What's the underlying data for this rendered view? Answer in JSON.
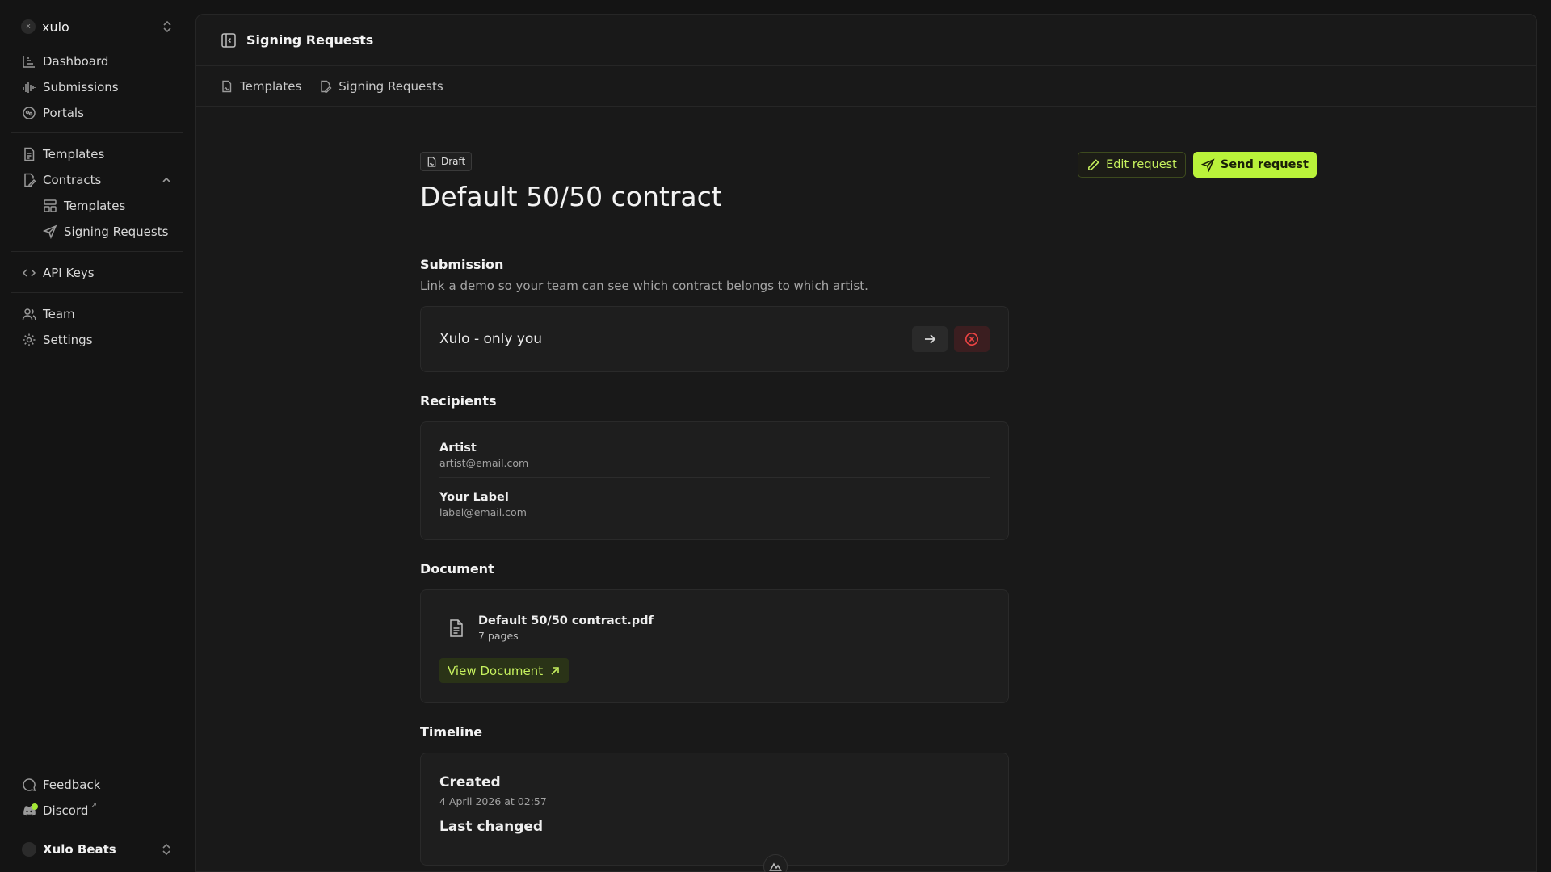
{
  "workspace": {
    "name": "xulo",
    "avatar_letter": "x"
  },
  "sidebar": {
    "group1": [
      {
        "label": "Dashboard",
        "icon": "chart-icon"
      },
      {
        "label": "Submissions",
        "icon": "waveform-icon"
      },
      {
        "label": "Portals",
        "icon": "portal-icon"
      }
    ],
    "templates": "Templates",
    "contracts": "Contracts",
    "contracts_sub": [
      "Templates",
      "Signing Requests"
    ],
    "api_keys": "API Keys",
    "team": "Team",
    "settings": "Settings",
    "feedback": "Feedback",
    "discord": "Discord",
    "profile_name": "Xulo Beats"
  },
  "topbar": {
    "title": "Signing Requests"
  },
  "breadcrumb": [
    "Templates",
    "Signing Requests"
  ],
  "request": {
    "status": "Draft",
    "title": "Default 50/50 contract",
    "edit_label": "Edit request",
    "send_label": "Send request"
  },
  "submission": {
    "title": "Submission",
    "description": "Link a demo so your team can see which contract belongs to which artist.",
    "linked": "Xulo - only you"
  },
  "recipients": {
    "title": "Recipients",
    "items": [
      {
        "name": "Artist",
        "email": "artist@email.com"
      },
      {
        "name": "Your Label",
        "email": "label@email.com"
      }
    ]
  },
  "document": {
    "title": "Document",
    "filename": "Default 50/50 contract.pdf",
    "pages": "7 pages",
    "view_label": "View Document"
  },
  "timeline": {
    "title": "Timeline",
    "created_label": "Created",
    "created_date": "4 April 2026 at 02:57",
    "changed_label": "Last changed"
  },
  "colors": {
    "accent": "#b9f23a",
    "danger": "#ef4444",
    "background": "#141414",
    "panel": "#191919"
  }
}
